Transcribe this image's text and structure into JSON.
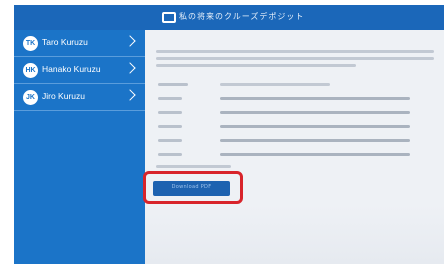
{
  "header": {
    "title": "私の将来のクルーズデポジット",
    "logo_icon": "ship-logo-icon"
  },
  "sidebar": {
    "items": [
      {
        "initials": "TK",
        "label": "Taro Kuruzu"
      },
      {
        "initials": "HK",
        "label": "Hanako Kuruzu"
      },
      {
        "initials": "JK",
        "label": "Jiro Kuruzu"
      }
    ]
  },
  "main": {
    "download_label": "Download PDF"
  },
  "colors": {
    "topbar": "#1b67b9",
    "sidebar": "#1b74c8",
    "button": "#1d62b0",
    "highlight": "#d8242b"
  }
}
